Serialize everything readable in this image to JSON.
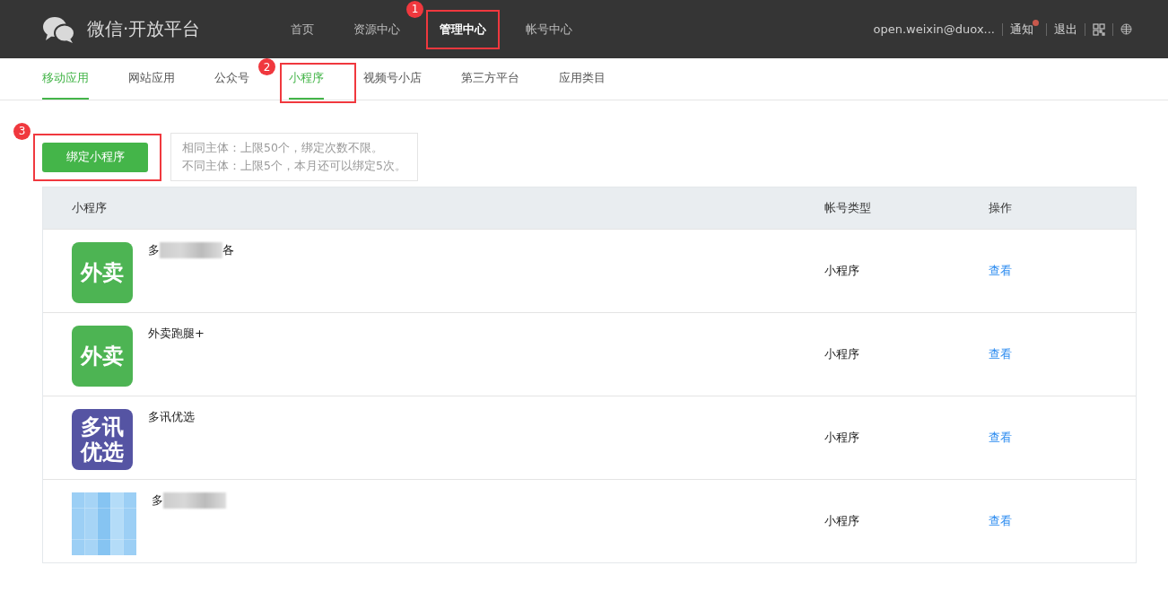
{
  "header": {
    "logo": "微信·开放平台",
    "nav": [
      {
        "label": "首页",
        "selected": false,
        "highlighted": false
      },
      {
        "label": "资源中心",
        "selected": false,
        "highlighted": false
      },
      {
        "label": "管理中心",
        "selected": true,
        "highlighted": true,
        "marker": "1"
      },
      {
        "label": "帐号中心",
        "selected": false,
        "highlighted": false
      }
    ],
    "account": "open.weixin@duox...",
    "notice": "通知",
    "notice_dot": true,
    "logout": "退出"
  },
  "tabs": [
    {
      "label": "移动应用",
      "selected": true,
      "highlighted": false
    },
    {
      "label": "网站应用",
      "selected": false,
      "highlighted": false
    },
    {
      "label": "公众号",
      "selected": false,
      "highlighted": false
    },
    {
      "label": "小程序",
      "selected": true,
      "highlighted": true,
      "marker": "2"
    },
    {
      "label": "视频号小店",
      "selected": false,
      "highlighted": false
    },
    {
      "label": "第三方平台",
      "selected": false,
      "highlighted": false
    },
    {
      "label": "应用类目",
      "selected": false,
      "highlighted": false
    }
  ],
  "bind_button": {
    "label": "绑定小程序",
    "highlighted": true,
    "marker": "3"
  },
  "hint": [
    "相同主体：上限50个，绑定次数不限。",
    "不同主体：上限5个，本月还可以绑定5次。"
  ],
  "table": {
    "columns": [
      "小程序",
      "帐号类型",
      "操作"
    ],
    "rows": [
      {
        "icon": {
          "kind": "text-green",
          "lines": [
            "外卖"
          ]
        },
        "name": [
          "多",
          "各"
        ],
        "type": "小程序",
        "action": "查看"
      },
      {
        "icon": {
          "kind": "text-green",
          "lines": [
            "外卖"
          ]
        },
        "name": [
          "外卖跑腿+"
        ],
        "type": "小程序",
        "action": "查看"
      },
      {
        "icon": {
          "kind": "text-purple",
          "lines": [
            "多讯",
            "优选"
          ]
        },
        "name": [
          "多讯优选"
        ],
        "type": "小程序",
        "action": "查看"
      },
      {
        "icon": {
          "kind": "blurred"
        },
        "name": [
          "多"
        ],
        "type": "小程序",
        "action": "查看"
      }
    ]
  }
}
